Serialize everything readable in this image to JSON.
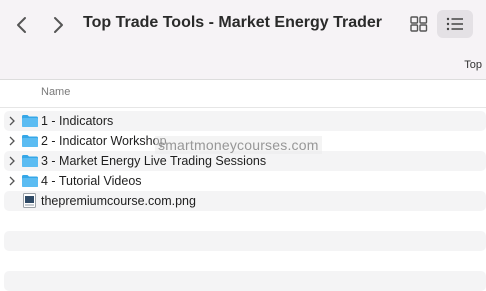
{
  "window": {
    "title": "Top Trade Tools - Market Energy Trader",
    "subbar_label": "Top"
  },
  "toolbar": {
    "back_icon": "chevron-left-icon",
    "forward_icon": "chevron-right-icon",
    "grid_view_icon": "grid-view-icon",
    "list_view_icon": "list-view-icon",
    "active_view": "list"
  },
  "columns": {
    "name": "Name"
  },
  "items": [
    {
      "label": "1 - Indicators",
      "type": "folder",
      "icon": "folder-icon"
    },
    {
      "label": "2 - Indicator Workshop",
      "type": "folder",
      "icon": "folder-icon"
    },
    {
      "label": "3 - Market Energy Live Trading Sessions",
      "type": "folder",
      "icon": "folder-icon"
    },
    {
      "label": "4 - Tutorial Videos",
      "type": "folder",
      "icon": "folder-icon"
    },
    {
      "label": "thepremiumcourse.com.png",
      "type": "file",
      "icon": "image-file-icon"
    }
  ],
  "watermark": "smartmoneycourses.com",
  "colors": {
    "folder": "#35a7e8",
    "toolbar_bg": "#f6f3f6",
    "alt_row": "#f4f4f5"
  }
}
